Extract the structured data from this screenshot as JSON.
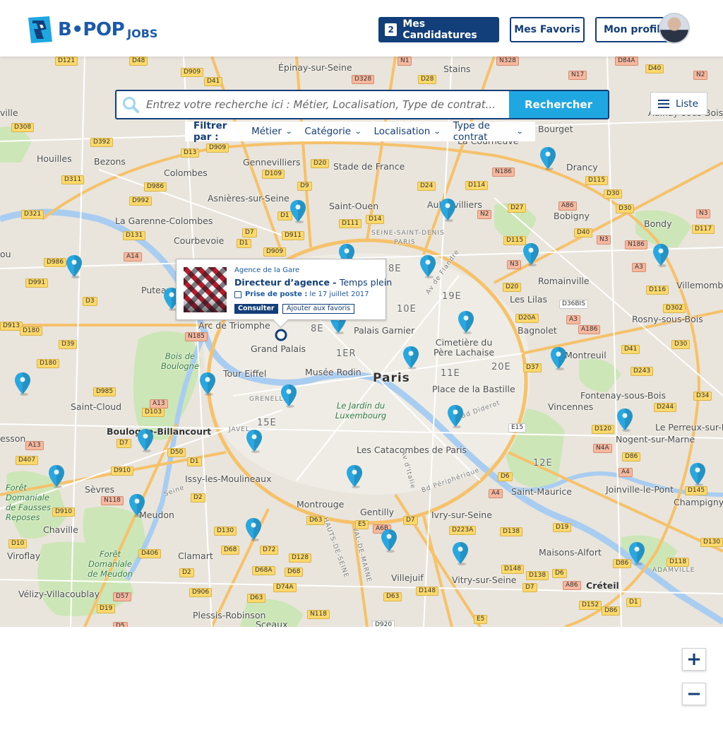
{
  "brand": {
    "logo_text": "B•POP",
    "logo_suffix": "JOBS"
  },
  "header": {
    "candidatures_count": "2",
    "candidatures_label": "Mes Candidatures",
    "favoris_label": "Mes Favoris",
    "profil_label": "Mon profil"
  },
  "search": {
    "placeholder": "Entrez votre recherche ici : Métier, Localisation, Type de contrat...",
    "button_label": "Rechercher"
  },
  "filters": {
    "label": "Filtrer par :",
    "items": [
      "Métier",
      "Catégorie",
      "Localisation",
      "Type de contrat"
    ]
  },
  "liste_label": "Liste",
  "popup": {
    "agency": "Agence de la Gare",
    "title": "Directeur d’agence",
    "separator": " - ",
    "contract": "Temps plein",
    "date_label": "Prise de poste :",
    "date_value": "le 17 juillet 2017",
    "consult_label": "Consulter",
    "favorite_label": "Ajouter aux favoris"
  },
  "zoom": {
    "in": "+",
    "out": "−"
  },
  "colors": {
    "brand": "#123f7a",
    "accent": "#1ea7e0",
    "pin": "#2aa7de"
  },
  "map": {
    "places": [
      "Épinay-sur-Seine",
      "Stains",
      "Gennevilliers",
      "Stade de France",
      "La Courneuve",
      "Drancy",
      "Houilles",
      "Bezons",
      "Colombes",
      "Asnières-sur-Seine",
      "Saint-Ouen",
      "Aubervilliers",
      "Bobigny",
      "Bondy",
      "La Garenne-Colombes",
      "Courbevoie",
      "Puteaux",
      "Romainville",
      "Les Lilas",
      "Bagnolet",
      "Rosny-sous-Bois",
      "Villemomble",
      "Arc de Triomphe",
      "Palais Garnier",
      "Grand Palais",
      "Tour Eiffel",
      "Musée Rodin",
      "Paris",
      "Cimetière du Père Lachaise",
      "Montreuil",
      "Place de la Bastille",
      "Fontenay-sous-Bois",
      "Bois de Boulogne",
      "Saint-Cloud",
      "Boulogne-Billancourt",
      "Vincennes",
      "Nogent-sur-Marne",
      "Le Perreux-sur-Marne",
      "Le Jardin du Luxembourg",
      "Les Catacombes de Paris",
      "Issy-les-Moulineaux",
      "Sèvres",
      "Meudon",
      "Forêt Domaniale de Fausses Reposes",
      "Chaville",
      "Montrouge",
      "Gentilly",
      "Ivry-sur-Seine",
      "Saint-Maurice",
      "Joinville-le-Pont",
      "Champigny",
      "Clamart",
      "Viroflay",
      "Forêt Domaniale de Meudon",
      "Villejuif",
      "Maisons-Alfort",
      "Créteil",
      "Vitry-sur-Seine",
      "Vélizy-Villacoublay",
      "Plessis-Robinson",
      "Sceaux",
      "ADAMVILLE",
      "Bd Périphérique",
      "Av de Flandre",
      "Av d'Italie",
      "Bd Diderot",
      "Seine",
      "SEINE-SAINT-DENIS",
      "HAUTS-DE-SEINE",
      "VAL-DE-MARNE",
      "PARIS",
      "GRENELLE",
      "JAVEL",
      "Aulnay-sous-Bois",
      "Bourget",
      "ville",
      "esson",
      "ou"
    ],
    "arrondissements": [
      "8E",
      "10E",
      "19E",
      "1ER",
      "11E",
      "20E",
      "15E",
      "12E"
    ],
    "roads": [
      "D121",
      "D48",
      "D909",
      "D41",
      "D328",
      "N1",
      "D28",
      "N17",
      "D40",
      "N2",
      "D308",
      "D392",
      "D13",
      "D909",
      "D20",
      "D114",
      "N186",
      "D115",
      "D30",
      "D311",
      "D986",
      "D109",
      "D9",
      "D24",
      "D27",
      "A86",
      "D30",
      "N3",
      "D117",
      "D321",
      "D992",
      "D1",
      "D14",
      "N2",
      "D40",
      "N3",
      "N186",
      "D131",
      "D7",
      "D911",
      "D111",
      "D115",
      "A3",
      "D116",
      "A14",
      "D986",
      "D909",
      "D1",
      "N3",
      "D36BIS",
      "D302",
      "D991",
      "D3",
      "D20",
      "D20A",
      "A3",
      "A186",
      "D913",
      "D180",
      "N185",
      "D39",
      "D41",
      "D180",
      "D37",
      "D243",
      "D30",
      "D985",
      "D103",
      "A13",
      "D244",
      "D34",
      "D120",
      "N4A",
      "E15",
      "D407",
      "D7",
      "D50",
      "D1",
      "D86",
      "A4",
      "A13",
      "D910",
      "D6",
      "D145",
      "N118",
      "D2",
      "A4",
      "D910",
      "D63",
      "E5",
      "D7",
      "D130",
      "D63",
      "A6B",
      "D223A",
      "D138",
      "D19",
      "D130",
      "D10",
      "D406",
      "D68",
      "D72",
      "D128",
      "D68",
      "D148",
      "D138",
      "D6",
      "D86",
      "D118",
      "D2",
      "D68A",
      "D74A",
      "A86",
      "D906",
      "D63",
      "D148",
      "D7",
      "D152",
      "D86",
      "D1",
      "D19",
      "D57",
      "N118",
      "D920",
      "E5",
      "D5",
      "A86",
      "N328",
      "D84A",
      "A1",
      "A4",
      "E5",
      "D120",
      "N4"
    ]
  }
}
